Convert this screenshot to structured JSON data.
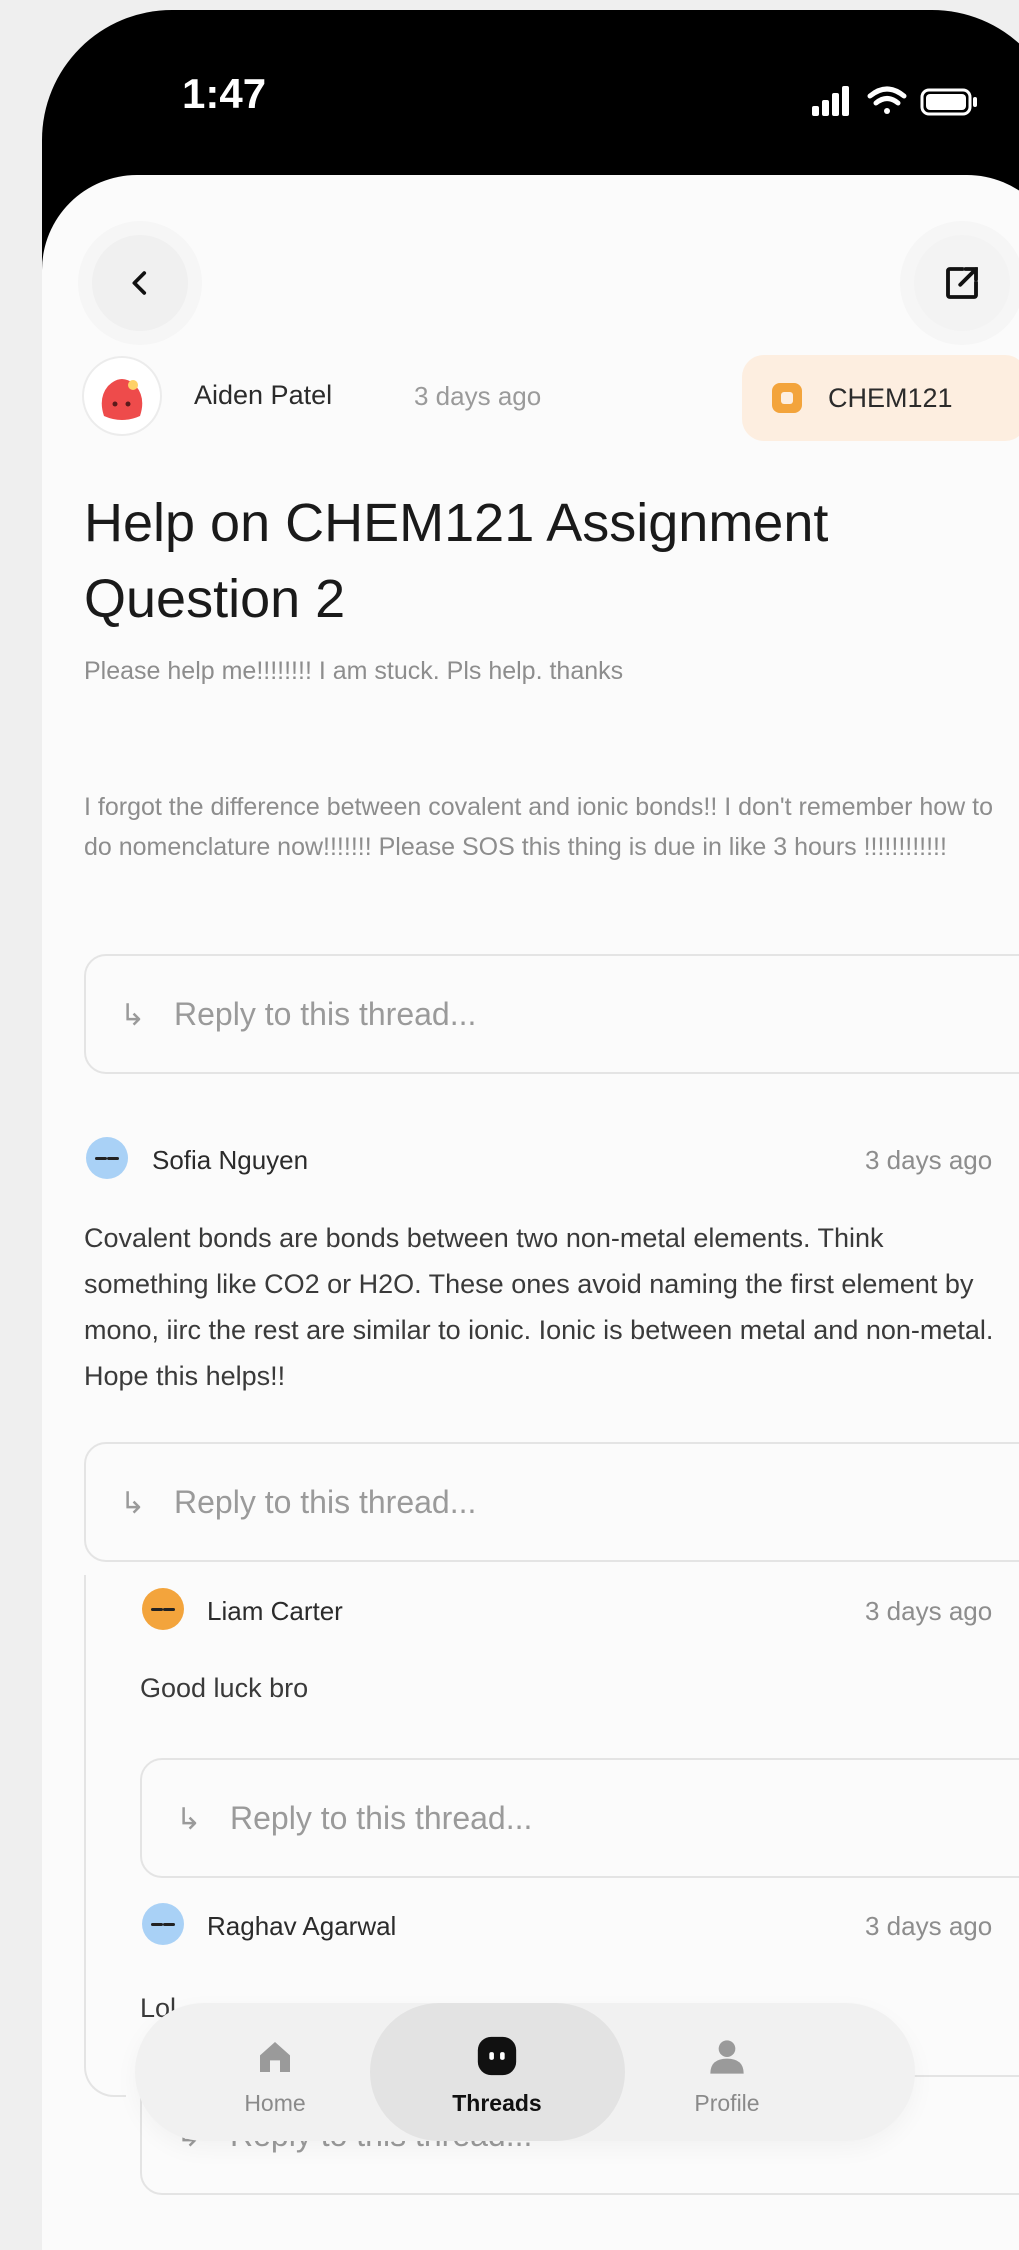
{
  "status": {
    "time": "1:47"
  },
  "post": {
    "author": "Aiden Patel",
    "time": "3 days ago",
    "tag": "CHEM121",
    "title": "Help on CHEM121 Assignment Question 2",
    "body_lines": [
      "Please help me!!!!!!!! I am stuck. Pls help. thanks",
      "I forgot the difference between covalent and ionic bonds!! I don't remember how to do nomenclature now!!!!!!! Please SOS this thing is due in like 3 hours !!!!!!!!!!!!"
    ],
    "reply_placeholder": "Reply to this thread..."
  },
  "comments": [
    {
      "author": "Sofia Nguyen",
      "time": "3 days ago",
      "body": "Covalent bonds are bonds between two non-metal elements. Think something like CO2 or H2O. These ones avoid naming the first element by mono, iirc the rest are similar to ionic. Ionic is between metal and non-metal. Hope this helps!!",
      "avatar_color": "#a9d1f6",
      "reply_placeholder": "Reply to this thread..."
    },
    {
      "author": "Liam Carter",
      "time": "3 days ago",
      "body": "Good luck bro",
      "avatar_color": "#f3a43c",
      "reply_placeholder": "Reply to this thread..."
    },
    {
      "author": "Raghav Agarwal",
      "time": "3 days ago",
      "body": "Lol",
      "avatar_color": "#a9d1f6",
      "reply_placeholder": "Reply to this thread..."
    }
  ],
  "nav": {
    "items": [
      {
        "label": "Home",
        "icon": "home-icon"
      },
      {
        "label": "Threads",
        "icon": "threads-icon",
        "active": true
      },
      {
        "label": "Profile",
        "icon": "profile-icon"
      }
    ]
  },
  "colors": {
    "accent_tag_bg": "#fdeee0",
    "accent_tag_icon": "#f3a43c",
    "author_avatar": "#ee4b4b"
  }
}
